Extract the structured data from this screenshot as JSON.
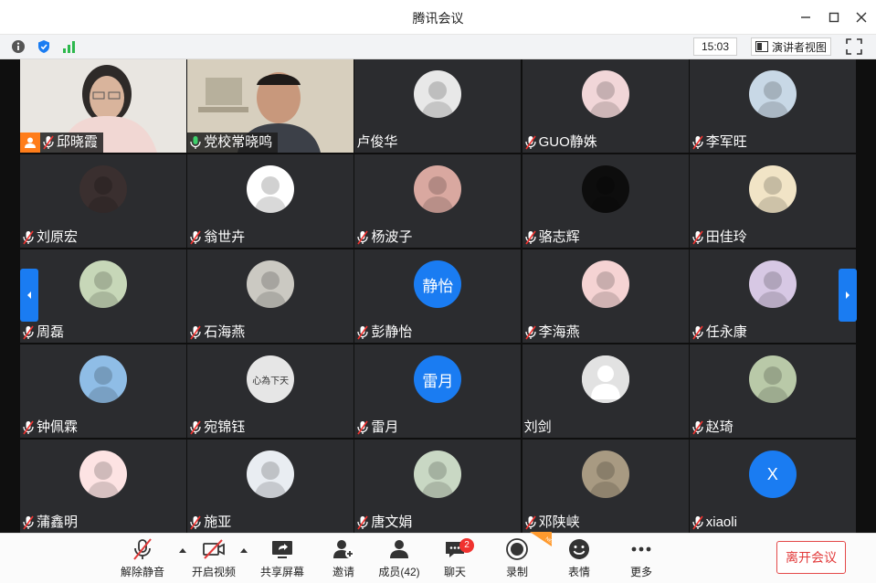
{
  "window": {
    "title": "腾讯会议"
  },
  "infobar": {
    "clock": "15:03",
    "speaker_view_label": "演讲者视图"
  },
  "participants": [
    {
      "name": "邱晓霞",
      "kind": "camera",
      "mic": "muted",
      "host": true
    },
    {
      "name": "党校常晓鸣",
      "kind": "camera",
      "mic": "on",
      "active": true
    },
    {
      "name": "卢俊华",
      "kind": "avatar",
      "mic": "none",
      "avatar_color": "#e8e8e8"
    },
    {
      "name": "GUO静姝",
      "kind": "avatar",
      "mic": "muted",
      "avatar_color": "#f1d6d8"
    },
    {
      "name": "李军旺",
      "kind": "avatar",
      "mic": "muted",
      "avatar_color": "#c8d8e6"
    },
    {
      "name": "刘原宏",
      "kind": "avatar",
      "mic": "muted",
      "avatar_color": "#3a2f2f"
    },
    {
      "name": "翁世卉",
      "kind": "avatar",
      "mic": "muted",
      "avatar_color": "#ffffff"
    },
    {
      "name": "杨波子",
      "kind": "avatar",
      "mic": "muted",
      "avatar_color": "#d9a8a0"
    },
    {
      "name": "骆志辉",
      "kind": "avatar",
      "mic": "muted",
      "avatar_color": "#0d0d0d"
    },
    {
      "name": "田佳玲",
      "kind": "avatar",
      "mic": "muted",
      "avatar_color": "#f1e4c6"
    },
    {
      "name": "周磊",
      "kind": "avatar",
      "mic": "muted",
      "avatar_color": "#c7d7b8"
    },
    {
      "name": "石海燕",
      "kind": "avatar",
      "mic": "muted",
      "avatar_color": "#cbc9c2"
    },
    {
      "name": "彭静怡",
      "kind": "initials",
      "initials": "静怡",
      "mic": "muted",
      "avatar_color": "#1a7cf2"
    },
    {
      "name": "李海燕",
      "kind": "avatar",
      "mic": "muted",
      "avatar_color": "#f5d3d3"
    },
    {
      "name": "任永康",
      "kind": "avatar",
      "mic": "muted",
      "avatar_color": "#d7c8e4"
    },
    {
      "name": "钟佩霖",
      "kind": "avatar",
      "mic": "muted",
      "avatar_color": "#8fbde6"
    },
    {
      "name": "宛锦钰",
      "kind": "avatar",
      "mic": "muted",
      "avatar_color": "#e6e6e6",
      "avatar_text": "心為下天"
    },
    {
      "name": "雷月",
      "kind": "initials",
      "initials": "雷月",
      "mic": "muted",
      "avatar_color": "#1a7cf2"
    },
    {
      "name": "刘剑",
      "kind": "default",
      "mic": "none",
      "avatar_color": "#dcdcdc"
    },
    {
      "name": "赵琦",
      "kind": "avatar",
      "mic": "muted",
      "avatar_color": "#b9c9a8"
    },
    {
      "name": "蒲鑫明",
      "kind": "avatar",
      "mic": "muted",
      "avatar_color": "#fde3e3"
    },
    {
      "name": "施亚",
      "kind": "avatar",
      "mic": "muted",
      "avatar_color": "#e9edf2"
    },
    {
      "name": "唐文娟",
      "kind": "avatar",
      "mic": "muted",
      "avatar_color": "#c9d8c4"
    },
    {
      "name": "邓陕峡",
      "kind": "avatar",
      "mic": "muted",
      "avatar_color": "#a89a82"
    },
    {
      "name": "xiaoli",
      "kind": "initials",
      "initials": "X",
      "mic": "muted",
      "avatar_color": "#1a7cf2"
    }
  ],
  "toolbar": {
    "unmute": "解除静音",
    "start_video": "开启视频",
    "share_screen": "共享屏幕",
    "invite": "邀请",
    "members": "成员(42)",
    "chat": "聊天",
    "chat_badge": "2",
    "record": "录制",
    "record_tag": "NEW",
    "reactions": "表情",
    "more": "更多",
    "leave": "离开会议"
  },
  "colors": {
    "accent": "#1a7cf2",
    "leave": "#e23a3a",
    "active_border": "#3ecf6b"
  }
}
